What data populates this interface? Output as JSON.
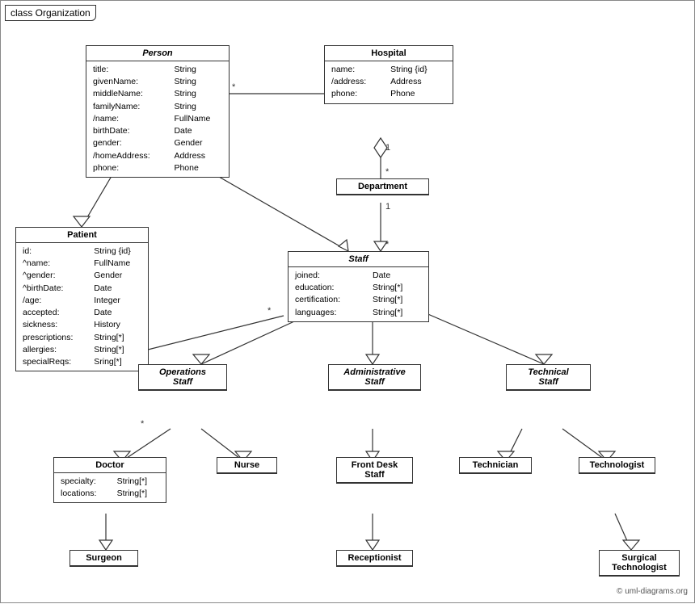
{
  "title": "class Organization",
  "copyright": "© uml-diagrams.org",
  "classes": {
    "person": {
      "name": "Person",
      "italic": true,
      "attributes": [
        {
          "name": "title:",
          "type": "String"
        },
        {
          "name": "givenName:",
          "type": "String"
        },
        {
          "name": "middleName:",
          "type": "String"
        },
        {
          "name": "familyName:",
          "type": "String"
        },
        {
          "name": "/name:",
          "type": "FullName"
        },
        {
          "name": "birthDate:",
          "type": "Date"
        },
        {
          "name": "gender:",
          "type": "Gender"
        },
        {
          "name": "/homeAddress:",
          "type": "Address"
        },
        {
          "name": "phone:",
          "type": "Phone"
        }
      ]
    },
    "hospital": {
      "name": "Hospital",
      "italic": false,
      "attributes": [
        {
          "name": "name:",
          "type": "String {id}"
        },
        {
          "name": "/address:",
          "type": "Address"
        },
        {
          "name": "phone:",
          "type": "Phone"
        }
      ]
    },
    "department": {
      "name": "Department",
      "italic": false,
      "attributes": []
    },
    "patient": {
      "name": "Patient",
      "italic": false,
      "attributes": [
        {
          "name": "id:",
          "type": "String {id}"
        },
        {
          "name": "^name:",
          "type": "FullName"
        },
        {
          "name": "^gender:",
          "type": "Gender"
        },
        {
          "name": "^birthDate:",
          "type": "Date"
        },
        {
          "name": "/age:",
          "type": "Integer"
        },
        {
          "name": "accepted:",
          "type": "Date"
        },
        {
          "name": "sickness:",
          "type": "History"
        },
        {
          "name": "prescriptions:",
          "type": "String[*]"
        },
        {
          "name": "allergies:",
          "type": "String[*]"
        },
        {
          "name": "specialReqs:",
          "type": "Sring[*]"
        }
      ]
    },
    "staff": {
      "name": "Staff",
      "italic": true,
      "attributes": [
        {
          "name": "joined:",
          "type": "Date"
        },
        {
          "name": "education:",
          "type": "String[*]"
        },
        {
          "name": "certification:",
          "type": "String[*]"
        },
        {
          "name": "languages:",
          "type": "String[*]"
        }
      ]
    },
    "operations_staff": {
      "name": "Operations\nStaff",
      "italic": true
    },
    "administrative_staff": {
      "name": "Administrative\nStaff",
      "italic": true
    },
    "technical_staff": {
      "name": "Technical\nStaff",
      "italic": true
    },
    "doctor": {
      "name": "Doctor",
      "italic": false,
      "attributes": [
        {
          "name": "specialty:",
          "type": "String[*]"
        },
        {
          "name": "locations:",
          "type": "String[*]"
        }
      ]
    },
    "nurse": {
      "name": "Nurse",
      "italic": false
    },
    "front_desk_staff": {
      "name": "Front Desk\nStaff",
      "italic": false
    },
    "technician": {
      "name": "Technician",
      "italic": false
    },
    "technologist": {
      "name": "Technologist",
      "italic": false
    },
    "surgeon": {
      "name": "Surgeon",
      "italic": false
    },
    "receptionist": {
      "name": "Receptionist",
      "italic": false
    },
    "surgical_technologist": {
      "name": "Surgical\nTechnologist",
      "italic": false
    }
  }
}
